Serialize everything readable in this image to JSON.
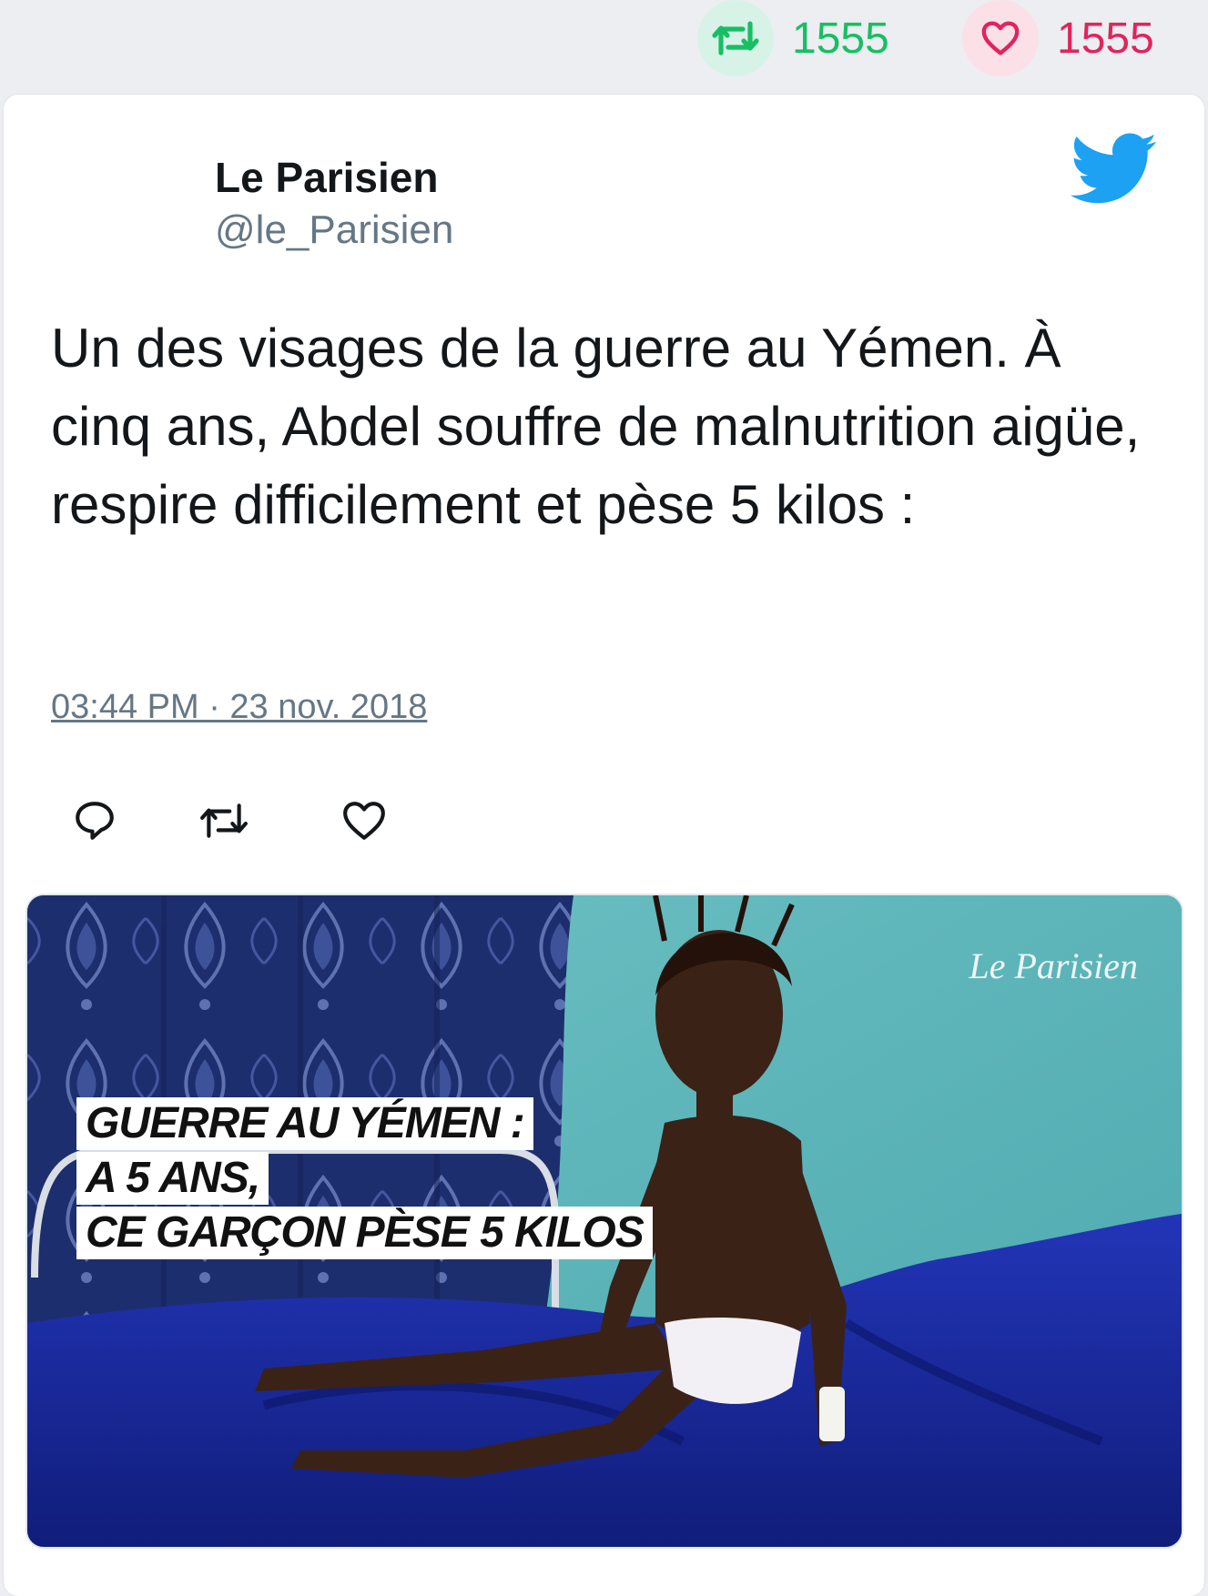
{
  "stats": {
    "retweets": "1555",
    "likes": "1555",
    "retweet_color": "#17bf63",
    "like_color": "#e0245e"
  },
  "tweet": {
    "author_name": "Le Parisien",
    "author_handle": "@le_Parisien",
    "text": "Un des visages de la guerre au Yémen. À cinq ans, Abdel souffre de malnutrition aigüe, respire difficilement et pèse 5 kilos :",
    "timestamp": "03:44 PM · 23 nov. 2018",
    "platform_icon": "twitter-bird-icon",
    "accent_color": "#1da1f2"
  },
  "actions": {
    "reply_icon": "reply-icon",
    "retweet_icon": "retweet-icon",
    "like_icon": "heart-icon"
  },
  "media": {
    "brand": "Le Parisien",
    "caption_lines": [
      "GUERRE AU YÉMEN :",
      "A 5 ANS,",
      "CE GARÇON PÈSE 5 KILOS"
    ]
  }
}
